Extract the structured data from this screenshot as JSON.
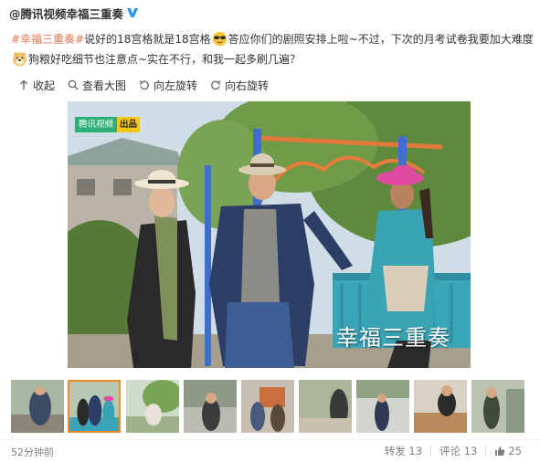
{
  "post": {
    "author": "@腾讯视频幸福三重奏",
    "verified_icon": "verified-v-icon",
    "text": {
      "hashtag": "#幸福三重奏#",
      "part1": "说好的18宫格就是18宫格",
      "emoji1": "sunglasses-emoji",
      "part2": "答应你们的剧照安排上啦~不过，下次的月考试卷我要加大难度",
      "emoji2": "doge-emoji",
      "part3": "狗粮好吃细节也注意点~实在不行，和我一起多刷几遍？"
    }
  },
  "toolbar": {
    "collapse": "收起",
    "view_large": "查看大图",
    "rotate_left": "向左旋转",
    "rotate_right": "向右旋转"
  },
  "photo": {
    "badge_brand": "腾讯视频",
    "badge_tag": "出品",
    "watermark": "幸福三重奏"
  },
  "thumbnails": {
    "count": 9,
    "active_index": 1
  },
  "footer": {
    "time": "52分钟前",
    "repost_label": "转发",
    "repost_count": "13",
    "comment_label": "评论",
    "comment_count": "13",
    "like_count": "25"
  },
  "colors": {
    "hashtag": "#eb7350",
    "verified": "#2196f3",
    "thumb_active_border": "#f08a24"
  }
}
